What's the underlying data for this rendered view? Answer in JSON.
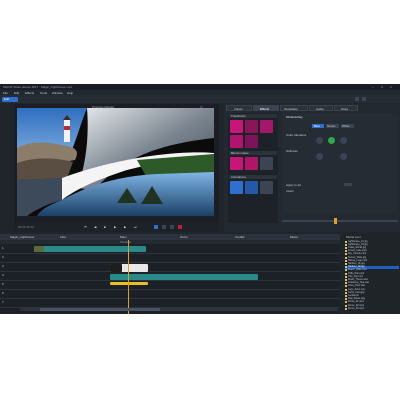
{
  "window": {
    "title": "MAGIX Video deluxe 2017 · Magic_Lighthouse.mvd",
    "menu": [
      "File",
      "Edit",
      "Effects",
      "Tools",
      "Window",
      "Help"
    ],
    "toolbar_left_label": "Edit",
    "controls": [
      "–",
      "□",
      "×"
    ]
  },
  "preview": {
    "title": "Program Monitor",
    "counter": "00:00:15:12"
  },
  "media_pool": {
    "tabs": [
      "Import",
      "Effects",
      "Templates",
      "Audio",
      "Store"
    ],
    "active_tab": 1,
    "sections": [
      "Transitions",
      "Blend modes",
      "Animations"
    ],
    "settings_title": "Chroma Key",
    "settings_options": [
      "Blue",
      "Green",
      "Other"
    ],
    "settings_labels": [
      "Color tolerance",
      "Softness",
      "Apply to all",
      "Invert"
    ]
  },
  "timeline": {
    "tabs": [
      "Magic_Lighthouse",
      "Intro",
      "Main",
      "Outro",
      "Credits",
      "Music"
    ],
    "tracks": [
      "1",
      "2",
      "3",
      "4",
      "5",
      "6",
      "7",
      "8"
    ],
    "mode_label": "Timeline"
  },
  "file_browser": {
    "header": "Media pool",
    "files": [
      "Lighthouse_01.jpg",
      "Lighthouse_02.jpg",
      "Coast_Rocks.jpg",
      "Forest_Lake.mp4",
      "Sky_Clouds.mp4",
      "Sunset_Wide.jpg",
      "Waves_Loop.mp4",
      "Harbour_01.jpg",
      "Harbour_02.jpg",
      "Beach_Walk.mp4",
      "Cliffs_Pan.mp4",
      "Title_Intro.mvt",
      "Music_Theme.wav",
      "Ambience_Sea.wav",
      "Voice_Over.wav",
      "Logo_Anim.mov",
      "Outro_Card.jpg",
      "Credits.txt",
      "Map_Route.png",
      "Drone_01.mp4",
      "Drone_02.mp4",
      "Drone_03.mp4"
    ],
    "selected_index": 8
  },
  "colors": {
    "accent": "#2e6fd0",
    "magenta": "#c8157a",
    "teal": "#2a8a8a",
    "yellow": "#e8c020",
    "selection": "#1c5fc0"
  }
}
